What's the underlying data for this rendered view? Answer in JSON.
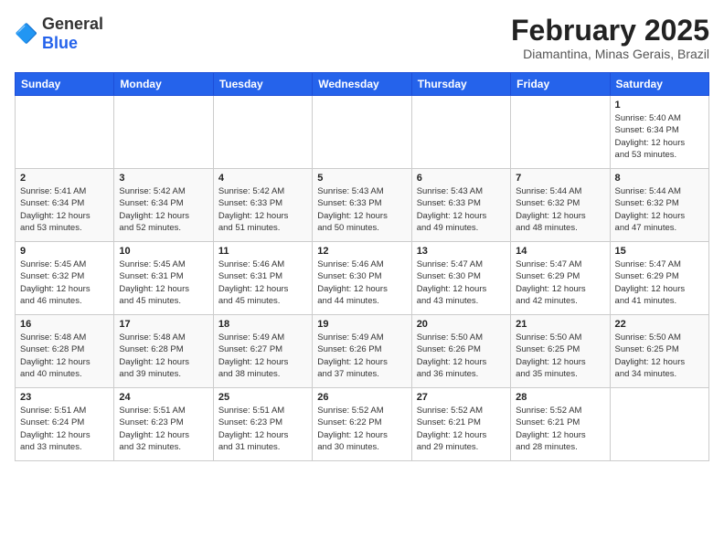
{
  "logo": {
    "general": "General",
    "blue": "Blue"
  },
  "header": {
    "month_year": "February 2025",
    "location": "Diamantina, Minas Gerais, Brazil"
  },
  "weekdays": [
    "Sunday",
    "Monday",
    "Tuesday",
    "Wednesday",
    "Thursday",
    "Friday",
    "Saturday"
  ],
  "weeks": [
    [
      {
        "day": "",
        "info": ""
      },
      {
        "day": "",
        "info": ""
      },
      {
        "day": "",
        "info": ""
      },
      {
        "day": "",
        "info": ""
      },
      {
        "day": "",
        "info": ""
      },
      {
        "day": "",
        "info": ""
      },
      {
        "day": "1",
        "info": "Sunrise: 5:40 AM\nSunset: 6:34 PM\nDaylight: 12 hours\nand 53 minutes."
      }
    ],
    [
      {
        "day": "2",
        "info": "Sunrise: 5:41 AM\nSunset: 6:34 PM\nDaylight: 12 hours\nand 53 minutes."
      },
      {
        "day": "3",
        "info": "Sunrise: 5:42 AM\nSunset: 6:34 PM\nDaylight: 12 hours\nand 52 minutes."
      },
      {
        "day": "4",
        "info": "Sunrise: 5:42 AM\nSunset: 6:33 PM\nDaylight: 12 hours\nand 51 minutes."
      },
      {
        "day": "5",
        "info": "Sunrise: 5:43 AM\nSunset: 6:33 PM\nDaylight: 12 hours\nand 50 minutes."
      },
      {
        "day": "6",
        "info": "Sunrise: 5:43 AM\nSunset: 6:33 PM\nDaylight: 12 hours\nand 49 minutes."
      },
      {
        "day": "7",
        "info": "Sunrise: 5:44 AM\nSunset: 6:32 PM\nDaylight: 12 hours\nand 48 minutes."
      },
      {
        "day": "8",
        "info": "Sunrise: 5:44 AM\nSunset: 6:32 PM\nDaylight: 12 hours\nand 47 minutes."
      }
    ],
    [
      {
        "day": "9",
        "info": "Sunrise: 5:45 AM\nSunset: 6:32 PM\nDaylight: 12 hours\nand 46 minutes."
      },
      {
        "day": "10",
        "info": "Sunrise: 5:45 AM\nSunset: 6:31 PM\nDaylight: 12 hours\nand 45 minutes."
      },
      {
        "day": "11",
        "info": "Sunrise: 5:46 AM\nSunset: 6:31 PM\nDaylight: 12 hours\nand 45 minutes."
      },
      {
        "day": "12",
        "info": "Sunrise: 5:46 AM\nSunset: 6:30 PM\nDaylight: 12 hours\nand 44 minutes."
      },
      {
        "day": "13",
        "info": "Sunrise: 5:47 AM\nSunset: 6:30 PM\nDaylight: 12 hours\nand 43 minutes."
      },
      {
        "day": "14",
        "info": "Sunrise: 5:47 AM\nSunset: 6:29 PM\nDaylight: 12 hours\nand 42 minutes."
      },
      {
        "day": "15",
        "info": "Sunrise: 5:47 AM\nSunset: 6:29 PM\nDaylight: 12 hours\nand 41 minutes."
      }
    ],
    [
      {
        "day": "16",
        "info": "Sunrise: 5:48 AM\nSunset: 6:28 PM\nDaylight: 12 hours\nand 40 minutes."
      },
      {
        "day": "17",
        "info": "Sunrise: 5:48 AM\nSunset: 6:28 PM\nDaylight: 12 hours\nand 39 minutes."
      },
      {
        "day": "18",
        "info": "Sunrise: 5:49 AM\nSunset: 6:27 PM\nDaylight: 12 hours\nand 38 minutes."
      },
      {
        "day": "19",
        "info": "Sunrise: 5:49 AM\nSunset: 6:26 PM\nDaylight: 12 hours\nand 37 minutes."
      },
      {
        "day": "20",
        "info": "Sunrise: 5:50 AM\nSunset: 6:26 PM\nDaylight: 12 hours\nand 36 minutes."
      },
      {
        "day": "21",
        "info": "Sunrise: 5:50 AM\nSunset: 6:25 PM\nDaylight: 12 hours\nand 35 minutes."
      },
      {
        "day": "22",
        "info": "Sunrise: 5:50 AM\nSunset: 6:25 PM\nDaylight: 12 hours\nand 34 minutes."
      }
    ],
    [
      {
        "day": "23",
        "info": "Sunrise: 5:51 AM\nSunset: 6:24 PM\nDaylight: 12 hours\nand 33 minutes."
      },
      {
        "day": "24",
        "info": "Sunrise: 5:51 AM\nSunset: 6:23 PM\nDaylight: 12 hours\nand 32 minutes."
      },
      {
        "day": "25",
        "info": "Sunrise: 5:51 AM\nSunset: 6:23 PM\nDaylight: 12 hours\nand 31 minutes."
      },
      {
        "day": "26",
        "info": "Sunrise: 5:52 AM\nSunset: 6:22 PM\nDaylight: 12 hours\nand 30 minutes."
      },
      {
        "day": "27",
        "info": "Sunrise: 5:52 AM\nSunset: 6:21 PM\nDaylight: 12 hours\nand 29 minutes."
      },
      {
        "day": "28",
        "info": "Sunrise: 5:52 AM\nSunset: 6:21 PM\nDaylight: 12 hours\nand 28 minutes."
      },
      {
        "day": "",
        "info": ""
      }
    ]
  ]
}
